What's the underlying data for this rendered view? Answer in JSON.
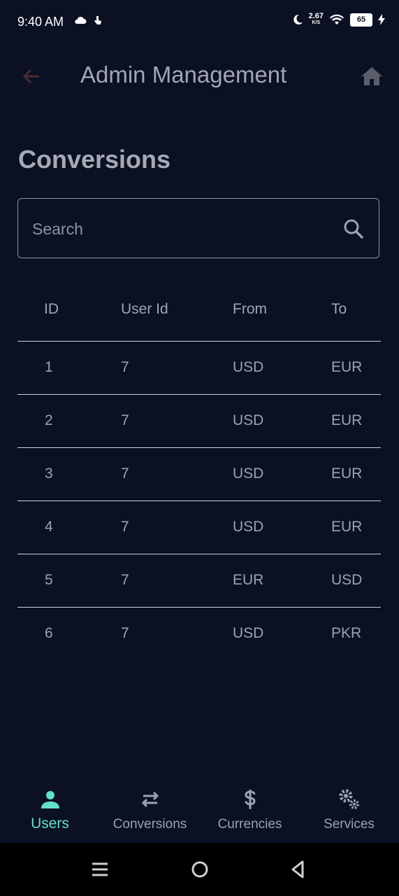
{
  "status_bar": {
    "time": "9:40 AM",
    "speed_value": "2.67",
    "speed_unit": "K/S",
    "battery": "65"
  },
  "app_bar": {
    "title": "Admin Management",
    "back_icon": "arrow-left-icon",
    "home_icon": "home-icon"
  },
  "page": {
    "title": "Conversions"
  },
  "search": {
    "placeholder": "Search",
    "value": ""
  },
  "table": {
    "headers": [
      "ID",
      "User Id",
      "From",
      "To"
    ],
    "rows": [
      [
        "1",
        "7",
        "USD",
        "EUR"
      ],
      [
        "2",
        "7",
        "USD",
        "EUR"
      ],
      [
        "3",
        "7",
        "USD",
        "EUR"
      ],
      [
        "4",
        "7",
        "USD",
        "EUR"
      ],
      [
        "5",
        "7",
        "EUR",
        "USD"
      ],
      [
        "6",
        "7",
        "USD",
        "PKR"
      ]
    ]
  },
  "bottom_nav": {
    "items": [
      {
        "label": "Users",
        "icon": "person-icon",
        "active": true
      },
      {
        "label": "Conversions",
        "icon": "swap-arrows-icon",
        "active": false
      },
      {
        "label": "Currencies",
        "icon": "dollar-icon",
        "active": false
      },
      {
        "label": "Services",
        "icon": "gears-icon",
        "active": false
      }
    ]
  },
  "colors": {
    "background": "#0b1023",
    "accent": "#62e0cb",
    "text": "#9ea2ad"
  }
}
